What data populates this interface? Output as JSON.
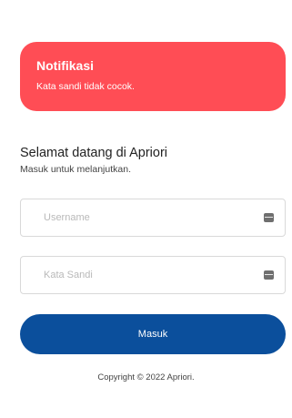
{
  "notification": {
    "title": "Notifikasi",
    "message": "Kata sandi tidak cocok.",
    "color": "#ff4d55"
  },
  "welcome": {
    "title": "Selamat datang di Apriori",
    "subtitle": "Masuk untuk melanjutkan."
  },
  "form": {
    "username": {
      "value": "",
      "placeholder": "Username",
      "icon": "id-card-icon"
    },
    "password": {
      "value": "",
      "placeholder": "Kata Sandi",
      "icon": "id-card-icon"
    },
    "submit_label": "Masuk",
    "submit_color": "#0b4f9c"
  },
  "footer": {
    "copyright": "Copyright © 2022 Apriori."
  }
}
